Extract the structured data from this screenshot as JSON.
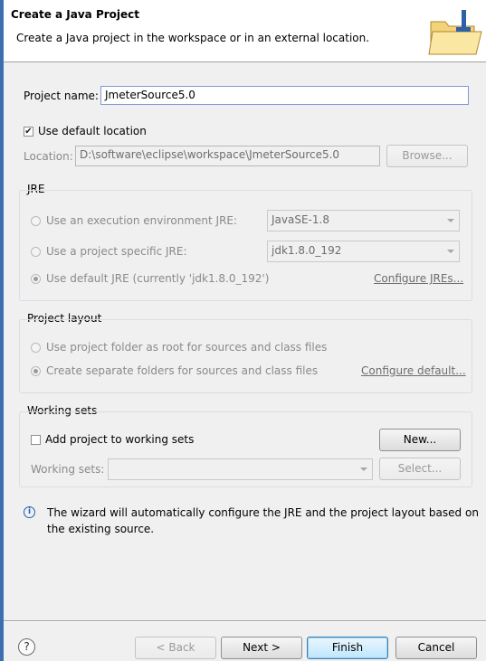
{
  "header": {
    "title": "Create a Java Project",
    "description": "Create a Java project in the workspace or in an external location."
  },
  "project": {
    "name_label": "Project name:",
    "name_value": "JmeterSource5.0",
    "use_default_location_label": "Use default location",
    "use_default_location_checked": true,
    "location_label": "Location:",
    "location_value": "D:\\software\\eclipse\\workspace\\JmeterSource5.0",
    "browse_label": "Browse..."
  },
  "jre": {
    "group_label": "JRE",
    "option_env_label": "Use an execution environment JRE:",
    "option_env_value": "JavaSE-1.8",
    "option_specific_label": "Use a project specific JRE:",
    "option_specific_value": "jdk1.8.0_192",
    "option_default_label": "Use default JRE (currently 'jdk1.8.0_192')",
    "configure_link": "Configure JREs..."
  },
  "layout": {
    "group_label": "Project layout",
    "option_root_label": "Use project folder as root for sources and class files",
    "option_separate_label": "Create separate folders for sources and class files",
    "configure_link": "Configure default..."
  },
  "working_sets": {
    "group_label": "Working sets",
    "add_label": "Add project to working sets",
    "add_checked": false,
    "new_label": "New...",
    "sets_label": "Working sets:",
    "select_label": "Select..."
  },
  "info": {
    "message_line1": "The wizard will automatically configure the JRE and the project layout based on",
    "message_line2": "the existing source."
  },
  "footer": {
    "help_symbol": "?",
    "back_label": "< Back",
    "next_label": "Next >",
    "finish_label": "Finish",
    "cancel_label": "Cancel"
  },
  "icons": {
    "header": "folder-icon",
    "info": "info-icon",
    "help": "help-icon"
  }
}
